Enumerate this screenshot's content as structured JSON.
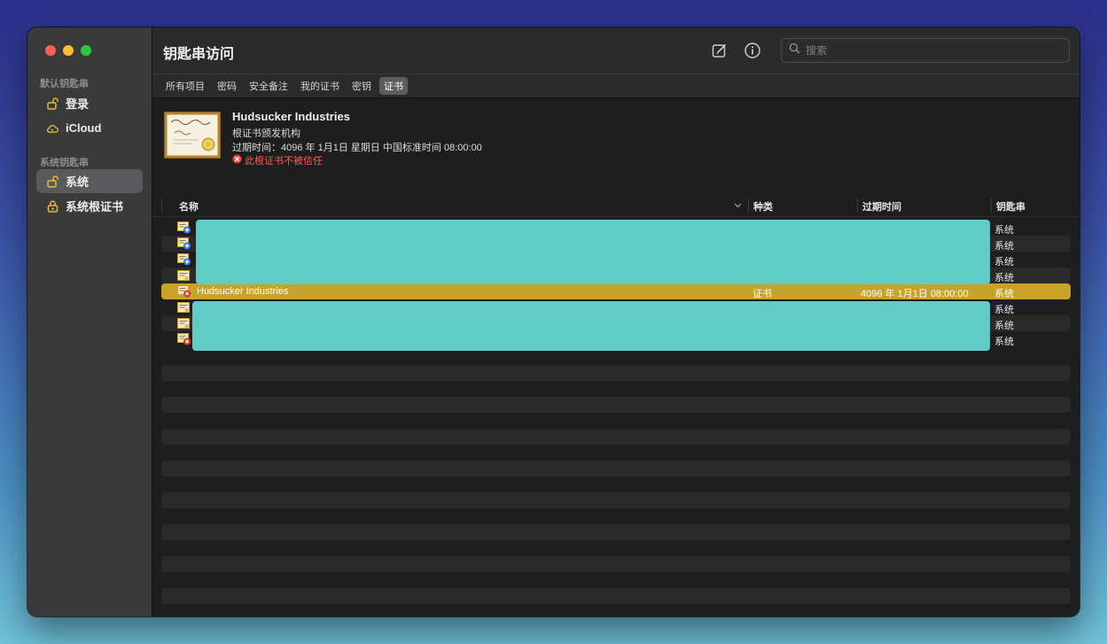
{
  "window": {
    "title": "钥匙串访问"
  },
  "colors": {
    "accent": "#c9a227",
    "redaction": "#5ecdc5",
    "warning": "#ff5b4f"
  },
  "sidebar": {
    "section1": "默认钥匙串",
    "items1": [
      {
        "label": "登录",
        "icon": "unlocked-padlock-icon"
      },
      {
        "label": "iCloud",
        "icon": "cloud-icon"
      }
    ],
    "section2": "系统钥匙串",
    "items2": [
      {
        "label": "系统",
        "icon": "unlocked-padlock-icon",
        "selected": true
      },
      {
        "label": "系统根证书",
        "icon": "locked-padlock-icon"
      }
    ]
  },
  "toolbar": {
    "compose_icon": "compose-icon",
    "info_icon": "info-icon",
    "search_placeholder": "搜索"
  },
  "tabs": [
    {
      "label": "所有项目",
      "active": false
    },
    {
      "label": "密码",
      "active": false
    },
    {
      "label": "安全备注",
      "active": false
    },
    {
      "label": "我的证书",
      "active": false
    },
    {
      "label": "密钥",
      "active": false
    },
    {
      "label": "证书",
      "active": true
    }
  ],
  "certificate": {
    "name": "Hudsucker Industries",
    "type": "根证书颁发机构",
    "expiry": "过期时间：4096 年 1月1日 星期日 中国标准时间 08:00:00",
    "warning": "此根证书不被信任"
  },
  "table": {
    "columns": {
      "name": "名称",
      "kind": "种类",
      "expires": "过期时间",
      "keychain": "钥匙串"
    },
    "rows": [
      {
        "icon": "cert-blue-icon",
        "name": "",
        "kind": "",
        "expires": "",
        "keychain": "系统",
        "redacted": true
      },
      {
        "icon": "cert-blue-icon",
        "name": "",
        "kind": "",
        "expires": "",
        "keychain": "系统",
        "redacted": true
      },
      {
        "icon": "cert-blue-icon",
        "name": "",
        "kind": "",
        "expires": "",
        "keychain": "系统",
        "redacted": true
      },
      {
        "icon": "cert-icon",
        "name": "",
        "kind": "",
        "expires": "",
        "keychain": "系统",
        "redacted": true
      },
      {
        "icon": "cert-untrusted-icon",
        "name": "Hudsucker Industries",
        "kind": "证书",
        "expires": "4096 年 1月1日 08:00:00",
        "keychain": "系统",
        "selected": true
      },
      {
        "icon": "cert-icon",
        "name": "",
        "kind": "",
        "expires": "",
        "keychain": "系统",
        "redacted": true
      },
      {
        "icon": "cert-icon",
        "name": "",
        "kind": "",
        "expires": "",
        "keychain": "系统",
        "redacted": true
      },
      {
        "icon": "cert-untrusted-icon",
        "name": "",
        "kind": "",
        "expires": "",
        "keychain": "系统",
        "redacted": true
      }
    ]
  }
}
